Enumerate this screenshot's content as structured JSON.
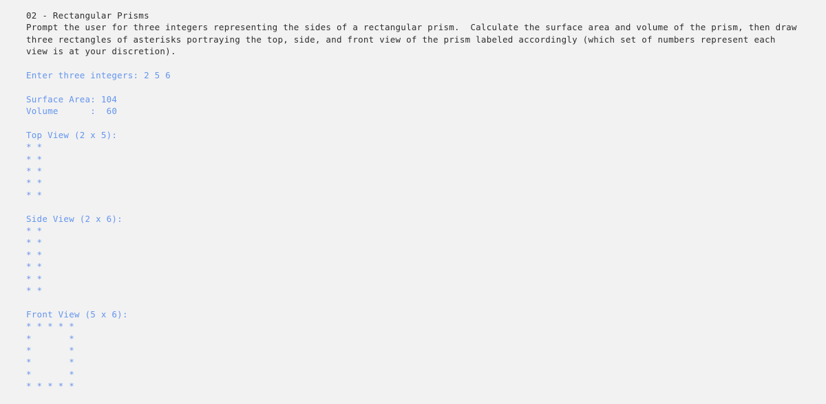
{
  "terminal": {
    "background_color": "#f2f2f2",
    "program_text_color": "#2d2d2d",
    "output_text_color": "#6495ed",
    "ascii_art_color": "#6c96e8",
    "assignment_title": "02 - Rectangular Prisms",
    "description_lines": [
      "Prompt the user for three integers representing the sides of a rectangular prism.  Calculate the surface area and volume of the prism, then draw",
      "three rectangles of asterisks portraying the top, side, and front view of the prism labeled accordingly (which set of numbers represent each",
      "view is at your discretion)."
    ],
    "prompt_label": "Enter three integers: ",
    "prompt_entered_value": "2 5 6",
    "prompt_line": "Enter three integers: 2 5 6",
    "results": {
      "surface_area_line": "Surface Area: 104",
      "volume_line": "Volume      :  60",
      "surface_area_label": "Surface Area:",
      "surface_area_value": "104",
      "volume_label": "Volume      :",
      "volume_value": "60"
    },
    "views": [
      {
        "id": "top-view",
        "heading": "Top View (2 x 5):",
        "width": 2,
        "height": 5,
        "rows": [
          "* *",
          "* *",
          "* *",
          "* *",
          "* *"
        ]
      },
      {
        "id": "side-view",
        "heading": "Side View (2 x 6):",
        "width": 2,
        "height": 6,
        "rows": [
          "* *",
          "* *",
          "* *",
          "* *",
          "* *",
          "* *"
        ]
      },
      {
        "id": "front-view",
        "heading": "Front View (5 x 6):",
        "width": 5,
        "height": 6,
        "rows": [
          "* * * * *",
          "*       *",
          "*       *",
          "*       *",
          "*       *",
          "* * * * *"
        ]
      }
    ],
    "inputs": {
      "length": 2,
      "width": 5,
      "height": 6
    }
  }
}
